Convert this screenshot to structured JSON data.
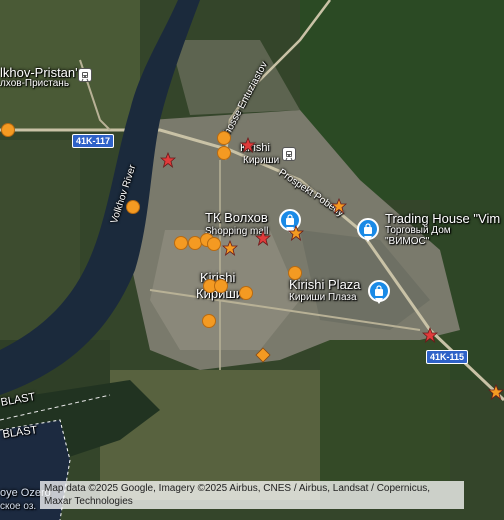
{
  "map": {
    "labels": {
      "volkhov_pristan_en": "lkhov-Pristan'",
      "volkhov_pristan_ru": "лхов-Пристань",
      "kirishi_station_en": "Kirishi",
      "kirishi_station_ru": "Кириши",
      "tk_volkhov": "ТК Волхов",
      "shopping_mall": "Shopping mall",
      "trading_house_en": "Trading House \"Vim",
      "trading_house_ru1": "Торговый Дом",
      "trading_house_ru2": "\"ВИМОС\"",
      "city_en": "Kirishi",
      "city_ru": "Кириши",
      "kirishi_plaza_en": "Kirishi Plaza",
      "kirishi_plaza_ru": "Кириши Плаза",
      "shosse_entuziastov": "Shosse Entuziastov",
      "prospekt_pobedy": "Prospekt Pobedy",
      "volkhov_river": "Volkhov River",
      "oblast1": "BLAST",
      "oblast2": "BLAST",
      "lake_en": "oye Ozero",
      "lake_ru": "ское оз."
    },
    "road_shields": {
      "r41k117": "41K-117",
      "r41k115": "41K-115"
    },
    "icons": {
      "shopping": "shopping-bag-icon",
      "transit": "train-station-icon"
    },
    "colors": {
      "marker_circle": "#f49a22",
      "marker_star": "#e03b3b",
      "marker_star_orange": "#f49a22",
      "poi_pin": "#1a8ae6",
      "road_shield": "#2f62c8"
    },
    "attribution_line1": "Map data ©2025 Google, Imagery ©2025 Airbus, CNES / Airbus, Landsat / Copernicus, Maxar",
    "attribution_line2": "Technologies"
  }
}
